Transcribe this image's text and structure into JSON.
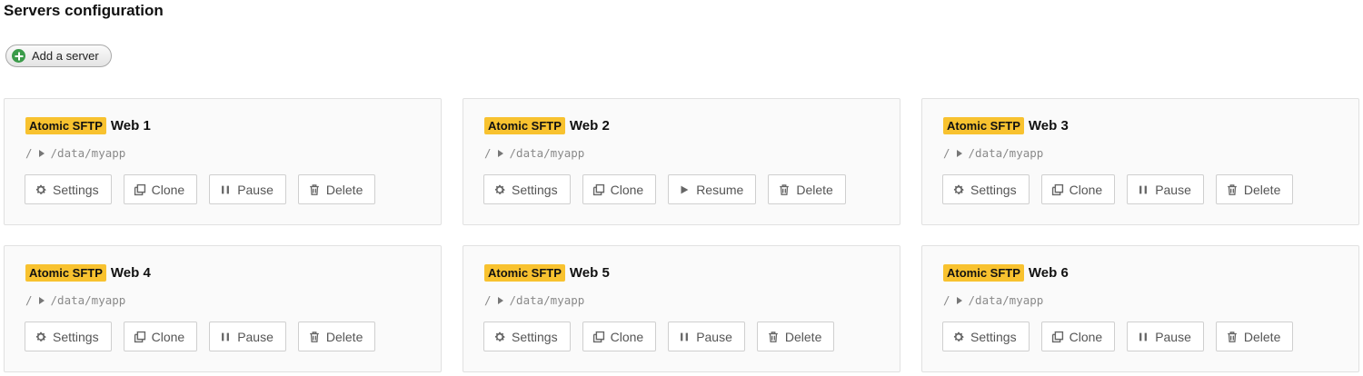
{
  "page": {
    "title": "Servers configuration",
    "add_button_label": "Add a server"
  },
  "servers": [
    {
      "badge": "Atomic SFTP",
      "name": "Web 1",
      "path_root": "/",
      "path": "/data/myapp",
      "actions": {
        "settings": "Settings",
        "clone": "Clone",
        "toggle": "Pause",
        "toggle_icon": "pause-icon",
        "delete": "Delete"
      }
    },
    {
      "badge": "Atomic SFTP",
      "name": "Web 2",
      "path_root": "/",
      "path": "/data/myapp",
      "actions": {
        "settings": "Settings",
        "clone": "Clone",
        "toggle": "Resume",
        "toggle_icon": "play-icon",
        "delete": "Delete"
      }
    },
    {
      "badge": "Atomic SFTP",
      "name": "Web 3",
      "path_root": "/",
      "path": "/data/myapp",
      "actions": {
        "settings": "Settings",
        "clone": "Clone",
        "toggle": "Pause",
        "toggle_icon": "pause-icon",
        "delete": "Delete"
      }
    },
    {
      "badge": "Atomic SFTP",
      "name": "Web 4",
      "path_root": "/",
      "path": "/data/myapp",
      "actions": {
        "settings": "Settings",
        "clone": "Clone",
        "toggle": "Pause",
        "toggle_icon": "pause-icon",
        "delete": "Delete"
      }
    },
    {
      "badge": "Atomic SFTP",
      "name": "Web 5",
      "path_root": "/",
      "path": "/data/myapp",
      "actions": {
        "settings": "Settings",
        "clone": "Clone",
        "toggle": "Pause",
        "toggle_icon": "pause-icon",
        "delete": "Delete"
      }
    },
    {
      "badge": "Atomic SFTP",
      "name": "Web 6",
      "path_root": "/",
      "path": "/data/myapp",
      "actions": {
        "settings": "Settings",
        "clone": "Clone",
        "toggle": "Pause",
        "toggle_icon": "pause-icon",
        "delete": "Delete"
      }
    }
  ],
  "colors": {
    "badge_bg": "#f8c22f",
    "add_icon": "#3b9b4a",
    "card_bg": "#fafafa",
    "card_border": "#e1e1e1"
  }
}
